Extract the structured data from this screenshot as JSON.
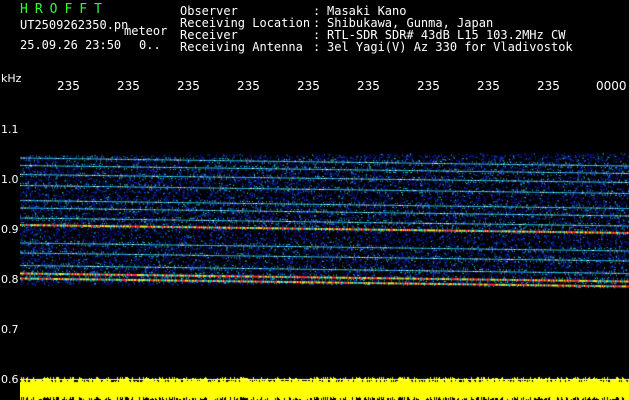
{
  "header": {
    "app_title": "HROFFT",
    "file_name": "UT2509262350.pn",
    "file_type": "meteor",
    "datetime": "25.09.26 23:50",
    "count": "0..",
    "fields": [
      {
        "label": "Observer",
        "value": "Masaki Kano"
      },
      {
        "label": "Receiving Location",
        "value": "Shibukawa, Gunma, Japan"
      },
      {
        "label": "Receiver",
        "value": "RTL-SDR SDR# 43dB L15 103.2MHz CW"
      },
      {
        "label": "Receiving Antenna",
        "value": "3el Yagi(V) Az 330 for Vladivostok"
      }
    ],
    "separator": ":"
  },
  "axis": {
    "y_unit": "kHz",
    "y_ticks": [
      "1.1",
      "1.0",
      "0.9",
      "0.8",
      "0.7",
      "0.6"
    ],
    "x_ticks": [
      "235",
      "235",
      "235",
      "235",
      "235",
      "235",
      "235",
      "235",
      "235",
      "0000"
    ]
  },
  "spectrogram": {
    "freq_range_khz": [
      0.6,
      1.1
    ],
    "signal_lines_khz": [
      1.045,
      1.03,
      1.012,
      0.99,
      0.96,
      0.945,
      0.925,
      0.912,
      0.875,
      0.855,
      0.83,
      0.815,
      0.805
    ],
    "strong_lines_khz": [
      0.912,
      0.815,
      0.805
    ],
    "noise_band_khz": [
      0.79,
      1.05
    ],
    "meteor_trace_khz": 0.6,
    "colors": {
      "background": "#000000",
      "noise_low": "#0a1ea8",
      "noise_mid": "#1ec8c8",
      "signal_high": "#e8e82a",
      "signal_peak": "#ff3030",
      "meteor_band": "#ffff00",
      "title_green": "#2cff2c"
    }
  }
}
